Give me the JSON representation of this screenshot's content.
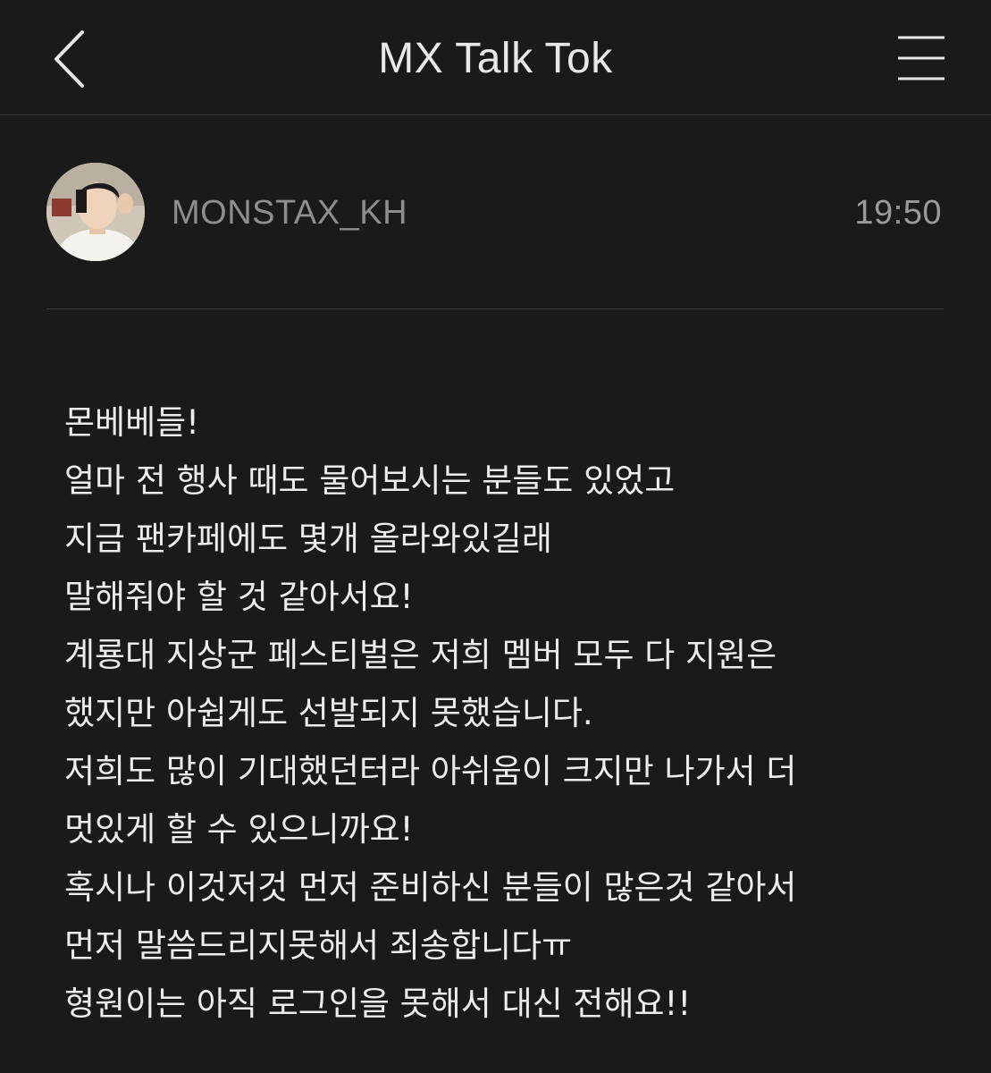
{
  "header": {
    "title": "MX Talk Tok",
    "back_icon": "chevron-left-icon",
    "menu_icon": "hamburger-menu-icon"
  },
  "post": {
    "author": "MONSTAX_KH",
    "time": "19:50",
    "avatar_icon": "user-avatar",
    "message_lines": [
      "몬베베들!",
      "얼마 전 행사 때도 물어보시는 분들도 있었고",
      "지금 팬카페에도 몇개 올라와있길래",
      "말해줘야 할 것 같아서요!",
      "계룡대 지상군 페스티벌은 저희 멤버 모두 다 지원은",
      "했지만 아쉽게도 선발되지 못했습니다.",
      "저희도 많이 기대했던터라 아쉬움이 크지만 나가서 더",
      "멋있게 할 수 있으니까요!",
      "혹시나 이것저것 먼저 준비하신 분들이 많은것 같아서",
      "먼저 말씀드리지못해서 죄송합니다ㅠ",
      "형원이는 아직 로그인을 못해서 대신 전해요!!"
    ]
  },
  "colors": {
    "background": "#1a1a1a",
    "text": "#ececec",
    "muted": "#8e8e8e",
    "divider": "#3a3a3a"
  }
}
